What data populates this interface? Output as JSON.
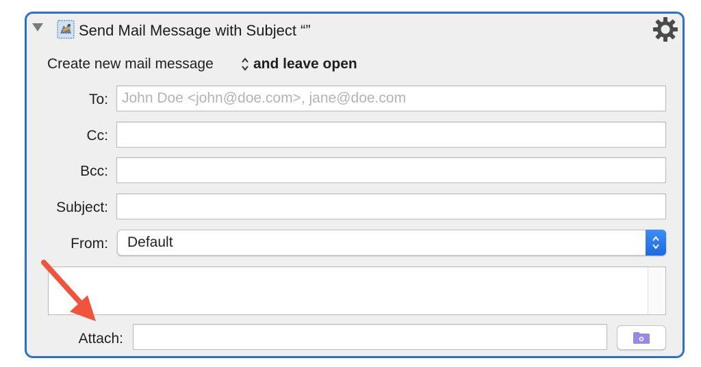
{
  "header": {
    "title": "Send Mail Message with Subject “”",
    "collapse_icon": "disclosure-triangle-icon",
    "app_icon": "mail-stamp-icon",
    "settings_icon": "gear-icon"
  },
  "mode": {
    "text": "Create new mail message",
    "selected": "and leave open"
  },
  "fields": {
    "to": {
      "label": "To:",
      "value": "",
      "placeholder": "John Doe <john@doe.com>, jane@doe.com"
    },
    "cc": {
      "label": "Cc:",
      "value": ""
    },
    "bcc": {
      "label": "Bcc:",
      "value": ""
    },
    "subject": {
      "label": "Subject:",
      "value": ""
    },
    "from": {
      "label": "From:",
      "selected": "Default"
    },
    "body": {
      "value": ""
    },
    "attach": {
      "label": "Attach:",
      "value": "",
      "button_icon": "folder-icon"
    }
  },
  "colors": {
    "accent": "#2a6fd6",
    "popup_button": "#2b7cf0",
    "annotation_arrow": "#f0543c",
    "folder_icon": "#9b88e0"
  }
}
